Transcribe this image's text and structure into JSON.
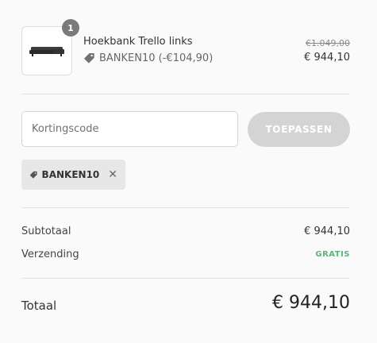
{
  "line_item": {
    "quantity": "1",
    "name": "Hoekbank Trello links",
    "discount_text": "BANKEN10 (-€104,90)",
    "original_price": "€1.049,00",
    "price": "€ 944,10",
    "image_icon": "sofa-icon",
    "tag_icon": "tag-icon"
  },
  "discount": {
    "placeholder": "Kortingscode",
    "apply_label": "TOEPASSEN",
    "applied_code": "BANKEN10",
    "remove_icon": "close-icon"
  },
  "summary": {
    "subtotal_label": "Subtotaal",
    "subtotal_value": "€ 944,10",
    "shipping_label": "Verzending",
    "shipping_value": "GRATIS",
    "total_label": "Totaal",
    "total_value": "€ 944,10"
  },
  "colors": {
    "free_green": "#5cb37a",
    "button_disabled": "#d4d4d4",
    "chip_bg": "#e7e7e7",
    "badge": "#7a7a7a"
  }
}
